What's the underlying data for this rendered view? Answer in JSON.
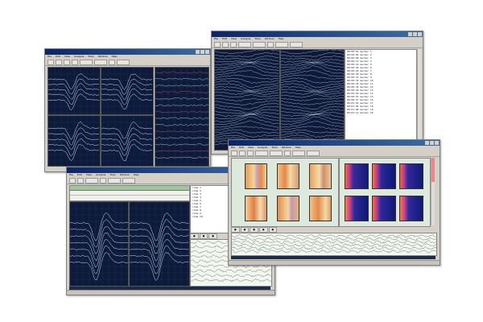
{
  "windows": [
    {
      "id": "win-back-left",
      "menus": [
        "File",
        "Edit",
        "View",
        "Analysis",
        "Tools",
        "Window",
        "Help"
      ]
    },
    {
      "id": "win-back-right",
      "menus": [
        "File",
        "Edit",
        "View",
        "Analysis",
        "Tools",
        "Window",
        "Help"
      ],
      "list_items": [
        "00:00:01 marker 1",
        "00:00:04 marker 2",
        "00:00:09 marker 3",
        "00:00:12 marker 4",
        "00:00:16 marker 5",
        "00:00:20 marker 6",
        "00:00:24 marker 7",
        "00:00:28 marker 8",
        "00:00:31 marker 9",
        "00:00:35 marker 10",
        "00:00:39 marker 11",
        "00:00:42 marker 12",
        "00:00:46 marker 13",
        "00:00:50 marker 14",
        "00:00:53 marker 15",
        "00:00:57 marker 16",
        "00:01:01 marker 17",
        "00:01:04 marker 18",
        "00:01:08 marker 19",
        "00:01:12 marker 20"
      ]
    },
    {
      "id": "win-front-left",
      "menus": [
        "File",
        "Edit",
        "View",
        "Analysis",
        "Tools",
        "Window",
        "Help"
      ],
      "list_items": [
        "item 1",
        "item 2",
        "item 3",
        "item 4",
        "item 5",
        "item 6",
        "item 7",
        "item 8",
        "item 9",
        "item 10"
      ]
    },
    {
      "id": "win-front-right",
      "menus": [
        "File",
        "Edit",
        "View",
        "Analysis",
        "Tools",
        "Window",
        "Help"
      ]
    }
  ],
  "colors": {
    "panel_bg": "#0d1a3a",
    "trace": "#d8e0ee",
    "eeg_trace": "#2a4a3a",
    "title_start": "#0a246a",
    "title_end": "#3a6ea5"
  }
}
